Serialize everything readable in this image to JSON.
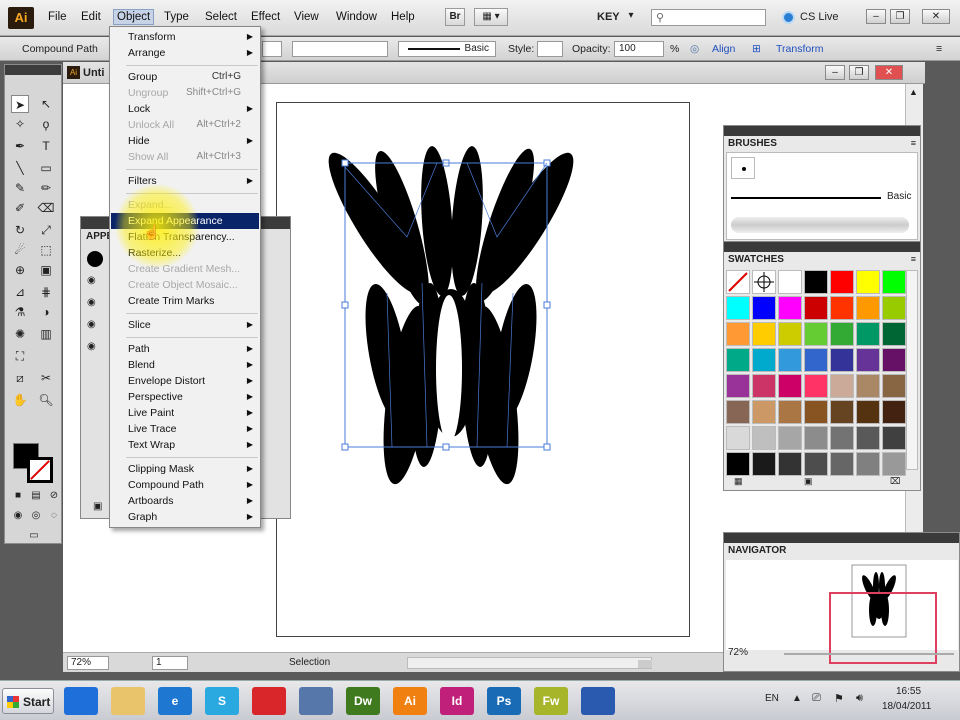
{
  "app": {
    "logo": "Ai"
  },
  "menubar": {
    "items": [
      "File",
      "Edit",
      "Object",
      "Type",
      "Select",
      "Effect",
      "View",
      "Window",
      "Help"
    ],
    "br": "Br",
    "workspace": "KEY",
    "search_placeholder": "",
    "cslive": "CS Live"
  },
  "control_bar": {
    "object_type": "Compound Path",
    "stroke_style": "Basic",
    "style_label": "Style:",
    "opacity_label": "Opacity:",
    "opacity_value": "100",
    "opacity_unit": "%",
    "align": "Align",
    "transform": "Transform"
  },
  "document": {
    "tab_title": "Unti",
    "zoom": "72%",
    "page": "1",
    "status": "Selection"
  },
  "appearance_panel": {
    "title": "APPE"
  },
  "object_menu": {
    "items": [
      {
        "label": "Transform",
        "submenu": true
      },
      {
        "label": "Arrange",
        "submenu": true
      },
      {
        "label": "Group",
        "shortcut": "Ctrl+G"
      },
      {
        "label": "Ungroup",
        "disabled": true,
        "shortcut": "Shift+Ctrl+G"
      },
      {
        "label": "Lock",
        "submenu": true
      },
      {
        "label": "Unlock All",
        "disabled": true,
        "shortcut": "Alt+Ctrl+2"
      },
      {
        "label": "Hide",
        "submenu": true
      },
      {
        "label": "Show All",
        "disabled": true,
        "shortcut": "Alt+Ctrl+3"
      },
      {
        "label": "Filters",
        "submenu": true
      },
      {
        "label": "Expand...",
        "disabled": true
      },
      {
        "label": "Expand Appearance",
        "highlighted": true
      },
      {
        "label": "Flatten Transparency..."
      },
      {
        "label": "Rasterize..."
      },
      {
        "label": "Create Gradient Mesh...",
        "disabled": true
      },
      {
        "label": "Create Object Mosaic...",
        "disabled": true
      },
      {
        "label": "Create Trim Marks"
      },
      {
        "label": "Slice",
        "submenu": true
      },
      {
        "label": "Path",
        "submenu": true
      },
      {
        "label": "Blend",
        "submenu": true
      },
      {
        "label": "Envelope Distort",
        "submenu": true
      },
      {
        "label": "Perspective",
        "submenu": true
      },
      {
        "label": "Live Paint",
        "submenu": true
      },
      {
        "label": "Live Trace",
        "submenu": true
      },
      {
        "label": "Text Wrap",
        "submenu": true
      },
      {
        "label": "Clipping Mask",
        "submenu": true
      },
      {
        "label": "Compound Path",
        "submenu": true
      },
      {
        "label": "Artboards",
        "submenu": true
      },
      {
        "label": "Graph",
        "submenu": true
      }
    ]
  },
  "panels": {
    "brushes": {
      "title": "BRUSHES",
      "brush_label": "Basic"
    },
    "swatches": {
      "title": "SWATCHES"
    },
    "navigator": {
      "title": "NAVIGATOR",
      "zoom": "72%"
    }
  },
  "swatch_colors": [
    "#ffffff",
    "#ffffff",
    "#ffffff",
    "#000000",
    "#ff0000",
    "#ffff00",
    "#00ff00",
    "#00ffff",
    "#0000ff",
    "#ff00ff",
    "#cc0000",
    "#ff3300",
    "#ff9900",
    "#99cc00",
    "#ff9933",
    "#ffcc00",
    "#cccc00",
    "#66cc33",
    "#33aa33",
    "#009966",
    "#006633",
    "#00aa88",
    "#00aacc",
    "#3399dd",
    "#3366cc",
    "#333399",
    "#663399",
    "#661166",
    "#993399",
    "#cc3366",
    "#cc0066",
    "#ff3366",
    "#ccaa99",
    "#aa8866",
    "#886644",
    "#886655",
    "#cc9966",
    "#aa7744",
    "#885522",
    "#664422",
    "#553311",
    "#442211",
    "#d9d9d9",
    "#bfbfbf",
    "#a6a6a6",
    "#8c8c8c",
    "#737373",
    "#595959",
    "#404040",
    "#000000",
    "#1a1a1a",
    "#333333",
    "#4d4d4d",
    "#666666",
    "#808080",
    "#999999"
  ],
  "taskbar": {
    "start": "Start",
    "apps": [
      {
        "label": "",
        "color": "#1e6fd9"
      },
      {
        "label": "",
        "color": "#e9c46a"
      },
      {
        "label": "e",
        "color": "#1e78d2"
      },
      {
        "label": "S",
        "color": "#2aa9e0"
      },
      {
        "label": "",
        "color": "#d9262b"
      },
      {
        "label": "",
        "color": "#5577aa"
      },
      {
        "label": "Dw",
        "color": "#3f7a1e"
      },
      {
        "label": "Ai",
        "color": "#f08010"
      },
      {
        "label": "Id",
        "color": "#c0207a"
      },
      {
        "label": "Ps",
        "color": "#1a6bb5"
      },
      {
        "label": "Fw",
        "color": "#a7b52a"
      },
      {
        "label": "",
        "color": "#2a5ab0"
      }
    ],
    "lang": "EN",
    "time": "16:55",
    "date": "18/04/2011"
  }
}
